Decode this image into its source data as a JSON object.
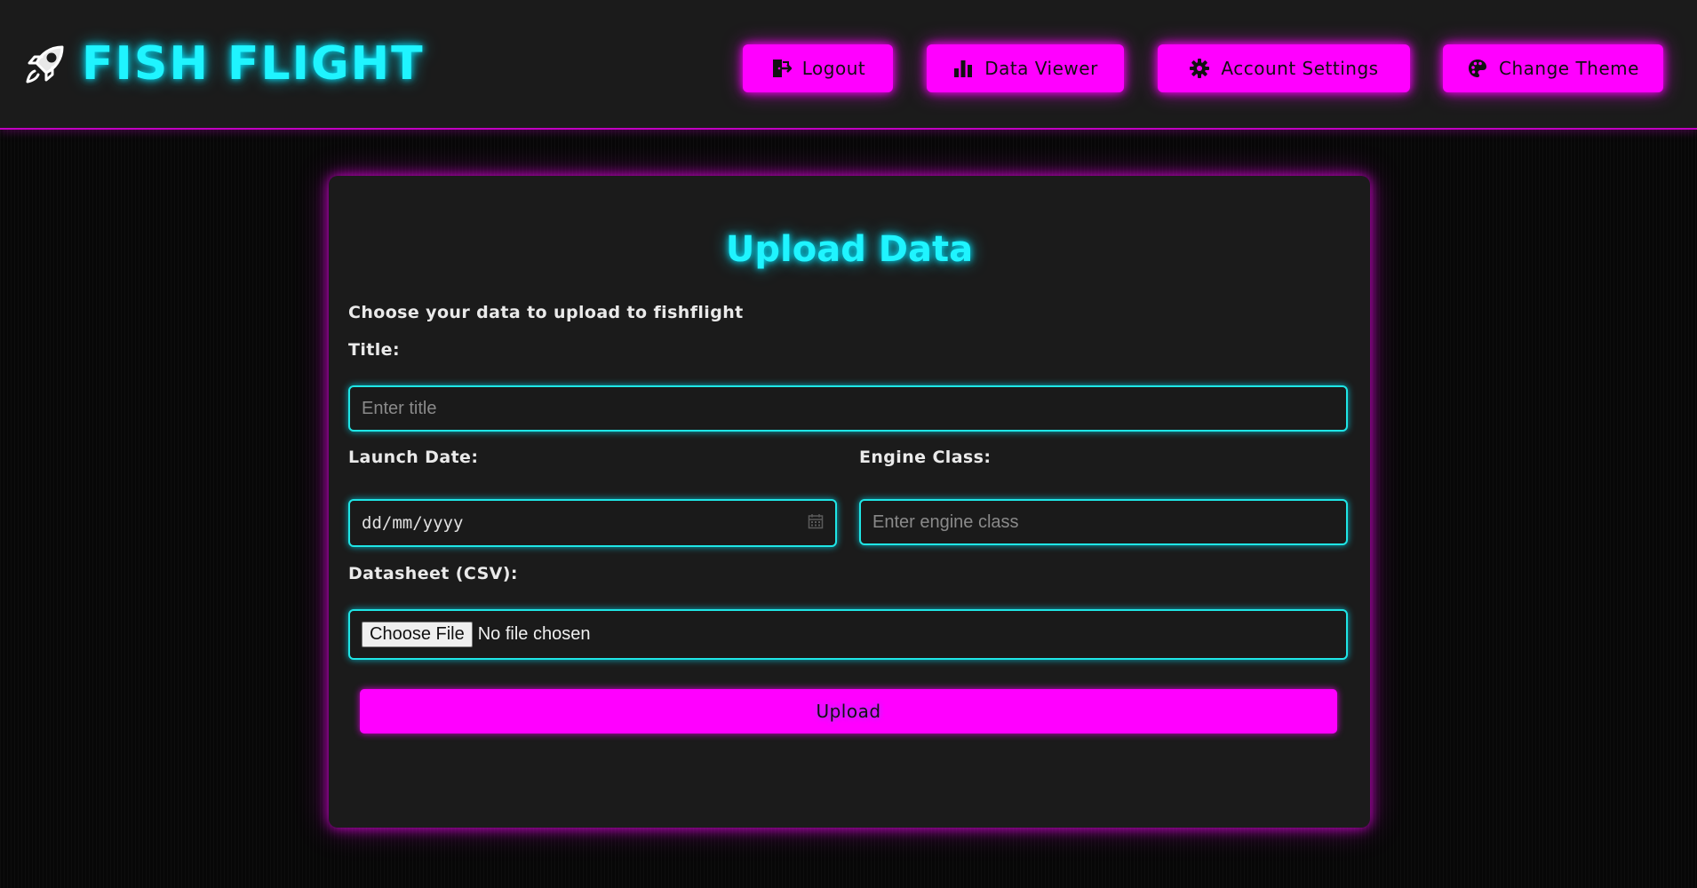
{
  "header": {
    "brand_title": "FISH FLIGHT",
    "nav": [
      {
        "label": "Logout",
        "icon": "logout-icon"
      },
      {
        "label": "Data Viewer",
        "icon": "bar-chart-icon"
      },
      {
        "label": "Account Settings",
        "icon": "gear-icon"
      },
      {
        "label": "Change Theme",
        "icon": "palette-icon"
      }
    ]
  },
  "form": {
    "title": "Upload Data",
    "intro": "Choose your data to upload to fishflight",
    "title_label": "Title:",
    "title_placeholder": "Enter title",
    "title_value": "",
    "launch_date_label": "Launch Date:",
    "launch_date_value": "dd/mm/yyyy",
    "engine_class_label": "Engine Class:",
    "engine_class_placeholder": "Enter engine class",
    "engine_class_value": "",
    "datasheet_label": "Datasheet (CSV):",
    "choose_file_label": "Choose File",
    "file_status": "No file chosen",
    "upload_label": "Upload"
  },
  "colors": {
    "accent_cyan": "#1ff4ff",
    "accent_magenta": "#ff00ff",
    "panel": "#1b1b1b"
  }
}
